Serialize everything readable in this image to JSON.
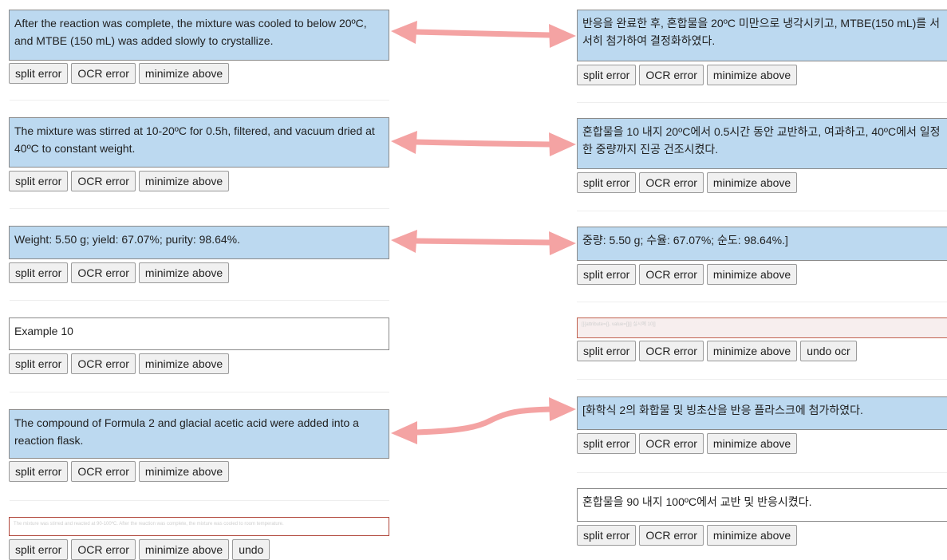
{
  "buttons": {
    "split": "split error",
    "ocr": "OCR error",
    "minimize": "minimize above",
    "undo": "undo",
    "undo_ocr": "undo ocr"
  },
  "left": [
    {
      "text": "After the reaction was complete, the mixture was cooled to below 20ºC, and MTBE (150 mL) was added slowly to crystallize."
    },
    {
      "text": "The mixture was stirred at 10-20ºC for 0.5h, filtered, and vacuum dried at 40ºC to constant weight."
    },
    {
      "text": "Weight: 5.50 g; yield: 67.07%; purity: 98.64%."
    },
    {
      "text": "Example 10"
    },
    {
      "text": "The compound of Formula 2 and glacial acetic acid were added into a reaction flask."
    },
    {
      "text": "The mixture was stirred and reacted at 90-100ºC. After the reaction was complete, the mixture was cooled to room temperature."
    }
  ],
  "right": [
    {
      "text": "반응을 완료한 후, 혼합물을 20ºC 미만으로 냉각시키고, MTBE(150 mL)를 서서히 첨가하여 결정화하였다."
    },
    {
      "text": "혼합물을 10 내지 20ºC에서 0.5시간 동안 교반하고, 여과하고, 40ºC에서 일정한 중량까지 진공 건조시켰다."
    },
    {
      "text": "중량: 5.50 g; 수율: 67.07%; 순도: 98.64%.]"
    },
    {
      "text": "[[{attribute={}, value=[]}] 실시예 10]]"
    },
    {
      "text": "[화학식 2의 화합물 및 빙초산을 반응 플라스크에 첨가하였다."
    },
    {
      "text": "혼합물을 90 내지 100ºC에서 교반 및 반응시켰다."
    }
  ],
  "colors": {
    "card_blue": "#bcd9f0",
    "arrow": "#f4a3a3",
    "error_border": "#b0463a"
  }
}
